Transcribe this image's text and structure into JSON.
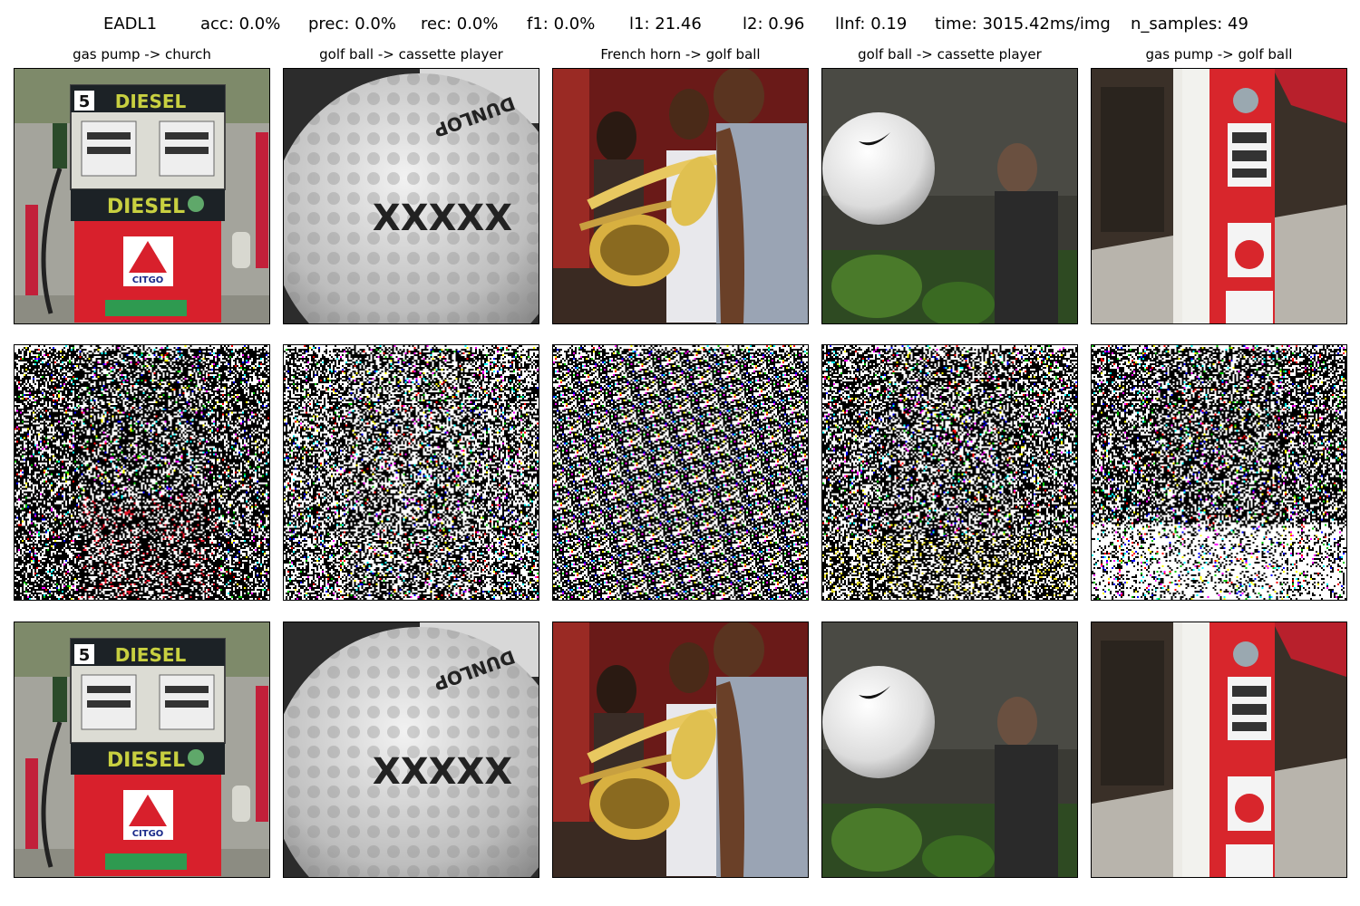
{
  "header": {
    "method": "EADL1",
    "acc": "acc: 0.0%",
    "prec": "prec: 0.0%",
    "rec": "rec: 0.0%",
    "f1": "f1: 0.0%",
    "l1": "l1: 21.46",
    "l2": "l2: 0.96",
    "linf": "lInf: 0.19",
    "time": "time: 3015.42ms/img",
    "n_samples": "n_samples: 49"
  },
  "columns": [
    {
      "title": "gas pump -> church",
      "scene": "gas-pump"
    },
    {
      "title": "golf ball -> cassette player",
      "scene": "golf-ball-closeup"
    },
    {
      "title": "French horn -> golf ball",
      "scene": "brass-players"
    },
    {
      "title": "golf ball -> cassette player",
      "scene": "golf-ball-flying"
    },
    {
      "title": "gas pump -> golf ball",
      "scene": "red-gas-pump"
    }
  ],
  "images": {
    "pump_top_label": "DIESEL",
    "pump_bottom_label": "DIESEL",
    "pump_brand": "CITGO",
    "pump_number": "5",
    "golf_ball_marking": "XXXXX",
    "golf_ball_brand": "DUNLOP"
  },
  "rows": [
    "original",
    "perturbation",
    "adversarial"
  ]
}
